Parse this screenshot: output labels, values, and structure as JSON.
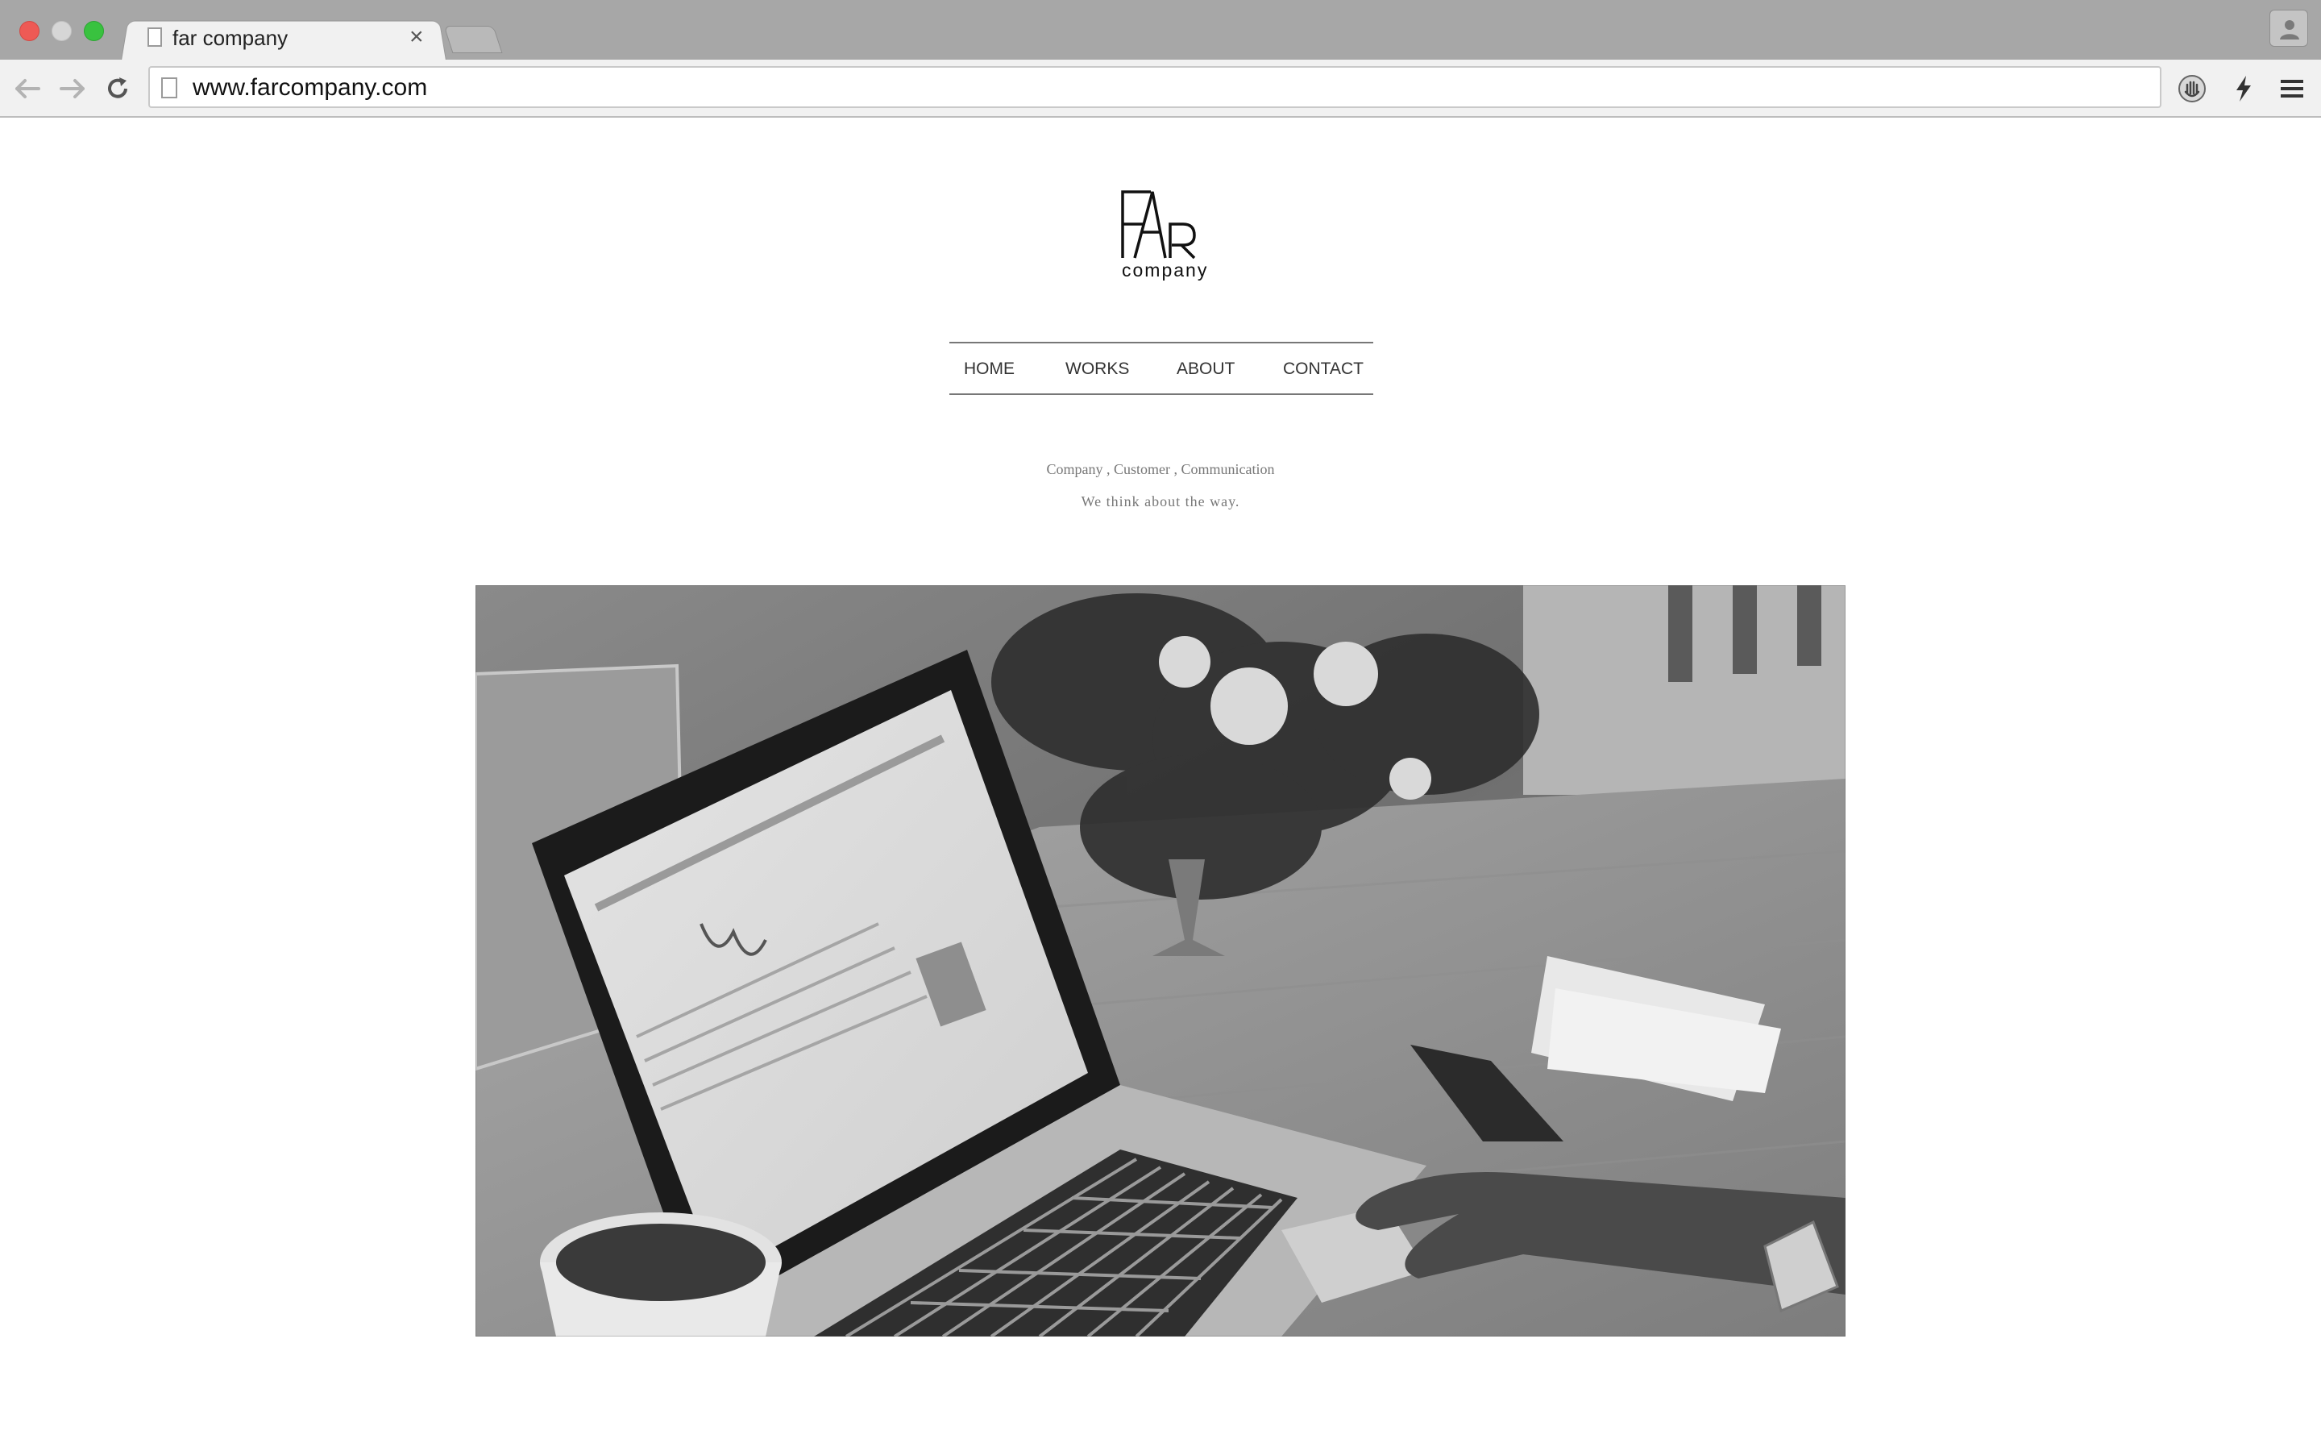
{
  "browser": {
    "tab_title": "far company",
    "tab_close": "×",
    "url": "www.farcompany.com"
  },
  "site": {
    "logo_text": "company",
    "nav": [
      "HOME",
      "WORKS",
      "ABOUT",
      "CONTACT"
    ],
    "tagline_line1": "Company , Customer , Communication",
    "tagline_line2": "We think about the way."
  },
  "colors": {
    "titlebar": "#a7a7a7",
    "toolbar": "#f1f1f1",
    "close_light": "#ee5a55",
    "maximize_light": "#39c23f",
    "nav_text": "#333333",
    "tagline_text": "#777777"
  }
}
